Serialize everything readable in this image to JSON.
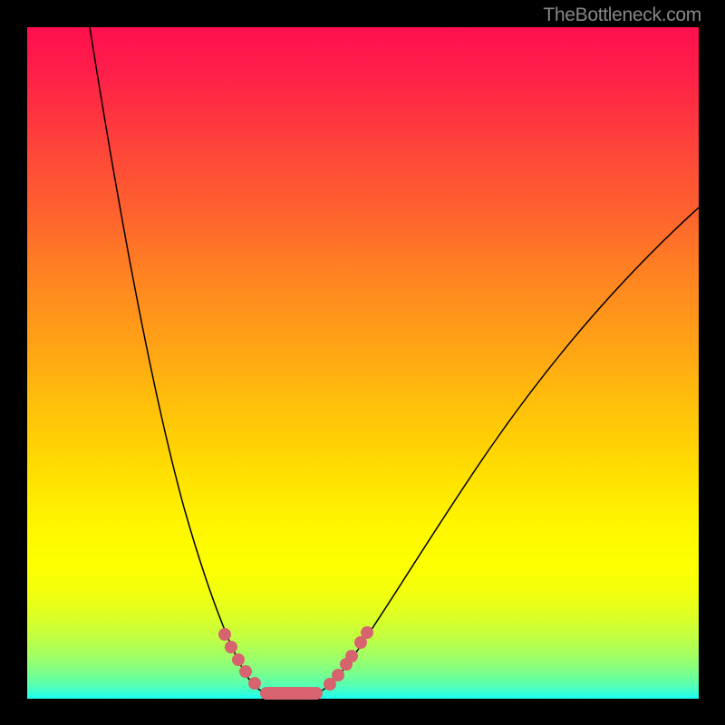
{
  "watermark": "TheBottleneck.com",
  "chart_data": {
    "type": "line",
    "title": "",
    "xlabel": "",
    "ylabel": "",
    "xlim": [
      0,
      100
    ],
    "ylim": [
      0,
      100
    ],
    "background_gradient": {
      "orientation": "vertical",
      "stops": [
        {
          "pos": 0,
          "color": "#fe104e"
        },
        {
          "pos": 50,
          "color": "#ffaa12"
        },
        {
          "pos": 80,
          "color": "#feff00"
        },
        {
          "pos": 100,
          "color": "#18fff3"
        }
      ]
    },
    "series": [
      {
        "name": "bottleneck-curve-left",
        "x": [
          9.3,
          15.5,
          22.0,
          27.0,
          30.5,
          33.0,
          35.0,
          36.0
        ],
        "values": [
          100,
          62,
          35,
          18,
          8,
          3,
          1,
          0.7
        ],
        "stroke": "#000000"
      },
      {
        "name": "bottleneck-curve-right",
        "x": [
          42.8,
          45.0,
          49.0,
          56.0,
          64.0,
          74.0,
          85.0,
          100.0
        ],
        "values": [
          0.7,
          2,
          7,
          17,
          29,
          45,
          60,
          73
        ],
        "stroke": "#000000"
      }
    ],
    "markers": {
      "color": "#d6636d",
      "radius_px": 7,
      "points_left": [
        {
          "x": 29.4,
          "y": 9.6
        },
        {
          "x": 30.4,
          "y": 7.7
        },
        {
          "x": 31.4,
          "y": 5.8
        },
        {
          "x": 32.5,
          "y": 4.0
        },
        {
          "x": 33.9,
          "y": 2.3
        }
      ],
      "points_right": [
        {
          "x": 45.1,
          "y": 2.2
        },
        {
          "x": 46.3,
          "y": 3.5
        },
        {
          "x": 47.5,
          "y": 5.1
        },
        {
          "x": 48.3,
          "y": 6.3
        },
        {
          "x": 49.7,
          "y": 8.4
        },
        {
          "x": 50.6,
          "y": 9.9
        }
      ],
      "flat_minimum": {
        "x_start": 34.7,
        "x_end": 44.0,
        "y": 0.7
      }
    },
    "annotations": [
      {
        "text": "TheBottleneck.com",
        "position": "top-right",
        "color": "#878787"
      }
    ]
  }
}
